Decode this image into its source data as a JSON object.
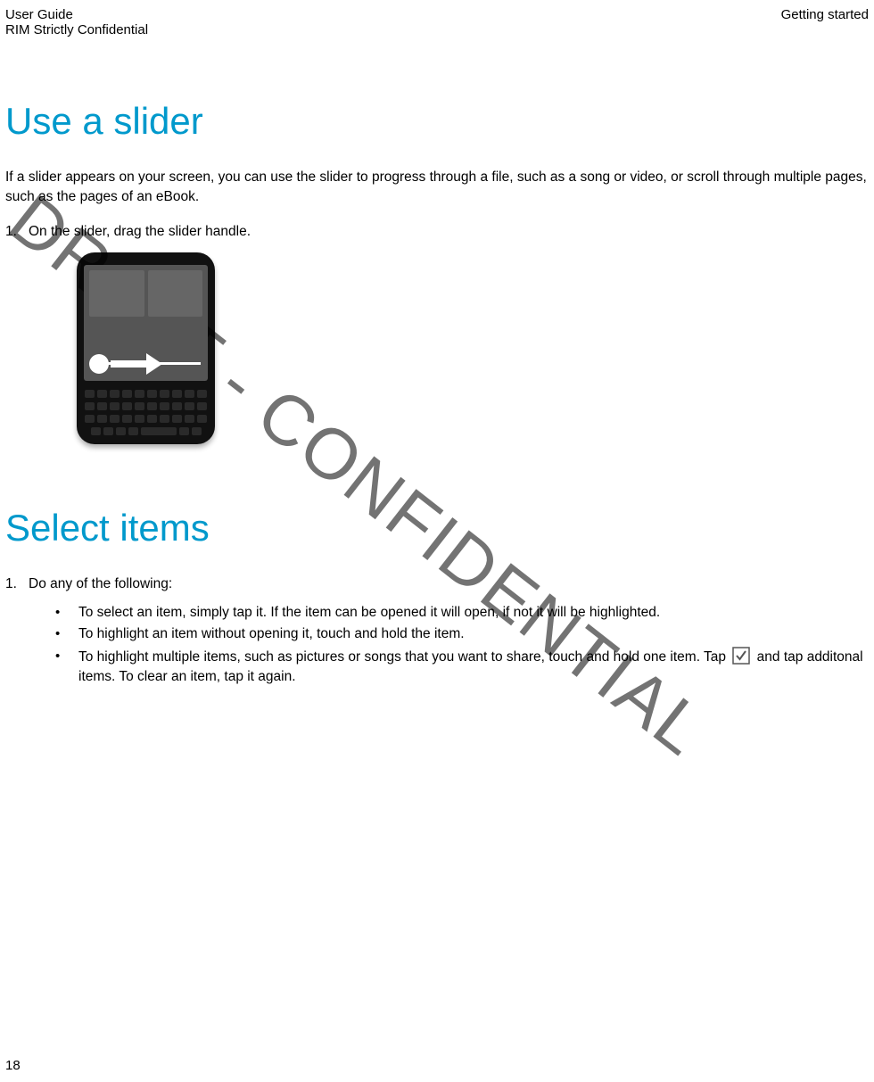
{
  "header": {
    "left1": "User Guide",
    "left2": "RIM Strictly Confidential",
    "right": "Getting started"
  },
  "section1": {
    "heading": "Use a slider",
    "intro": "If a slider appears on your screen, you can use the slider to progress through a file, such as a song or video, or scroll through multiple pages, such as the pages of an eBook.",
    "step1_num": "1.",
    "step1_text": "On the slider, drag the slider handle."
  },
  "section2": {
    "heading": "Select items",
    "step1_num": "1.",
    "step1_text": "Do any of the following:",
    "bullets": {
      "b1": "To select an item, simply tap it. If the item can be opened it will open, if not it will be highlighted.",
      "b2": "To highlight an item without opening it, touch and hold the item.",
      "b3a": "To highlight multiple items, such as pictures or songs that you want to share, touch and hold one item. Tap ",
      "b3b": " and tap additonal items. To clear an item, tap it again."
    }
  },
  "page_number": "18",
  "watermark": "DRAFT - CONFIDENTIAL",
  "icons": {
    "check": "check-icon"
  }
}
